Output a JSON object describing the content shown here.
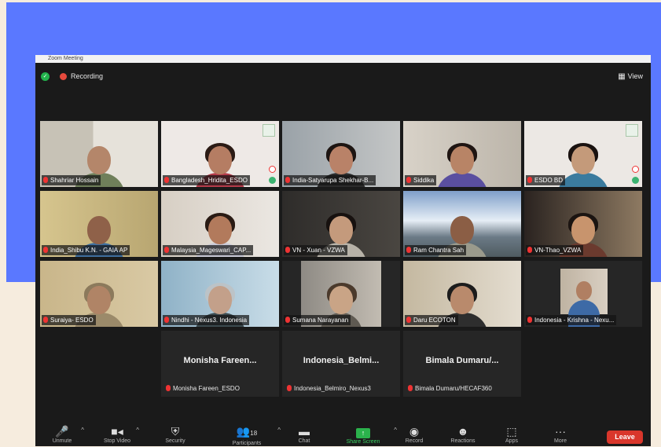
{
  "window": {
    "title": "Zoom Meeting"
  },
  "status": {
    "recording_label": "Recording",
    "view_label": "View"
  },
  "participants_row1": [
    {
      "name": "Shahriar Hossain"
    },
    {
      "name": "Bangladesh_Hridita_ESDO"
    },
    {
      "name": "India-Satyarupa Shekhar-B..."
    },
    {
      "name": "Siddika"
    },
    {
      "name": "ESDO BD"
    }
  ],
  "participants_row2": [
    {
      "name": "India_Shibu K.N. - GAIA AP"
    },
    {
      "name": "Malaysia_Mageswari_CAP..."
    },
    {
      "name": "VN - Xuan - VZWA"
    },
    {
      "name": "Ram Chantra Sah"
    },
    {
      "name": "VN-Thao_VZWA"
    }
  ],
  "participants_row3": [
    {
      "name": "Suraiya- ESDO"
    },
    {
      "name": "Nindhi - Nexus3. Indonesia"
    },
    {
      "name": "Sumana Narayanan"
    },
    {
      "name": "Daru ECOTON"
    },
    {
      "name": "Indonesia - Krishna - Nexu..."
    }
  ],
  "participants_row4": [
    {
      "display": "Monisha Fareen...",
      "name": "Monisha Fareen_ESDO"
    },
    {
      "display": "Indonesia_Belmi...",
      "name": "Indonesia_Belmiro_Nexus3"
    },
    {
      "display": "Bimala Dumaru/...",
      "name": "Bimala Dumaru/HECAF360"
    }
  ],
  "toolbar": {
    "unmute": "Unmute",
    "stop_video": "Stop Video",
    "security": "Security",
    "participants": "Participants",
    "participants_count": "18",
    "chat": "Chat",
    "share_screen": "Share Screen",
    "record": "Record",
    "reactions": "Reactions",
    "apps": "Apps",
    "more": "More",
    "leave": "Leave"
  }
}
